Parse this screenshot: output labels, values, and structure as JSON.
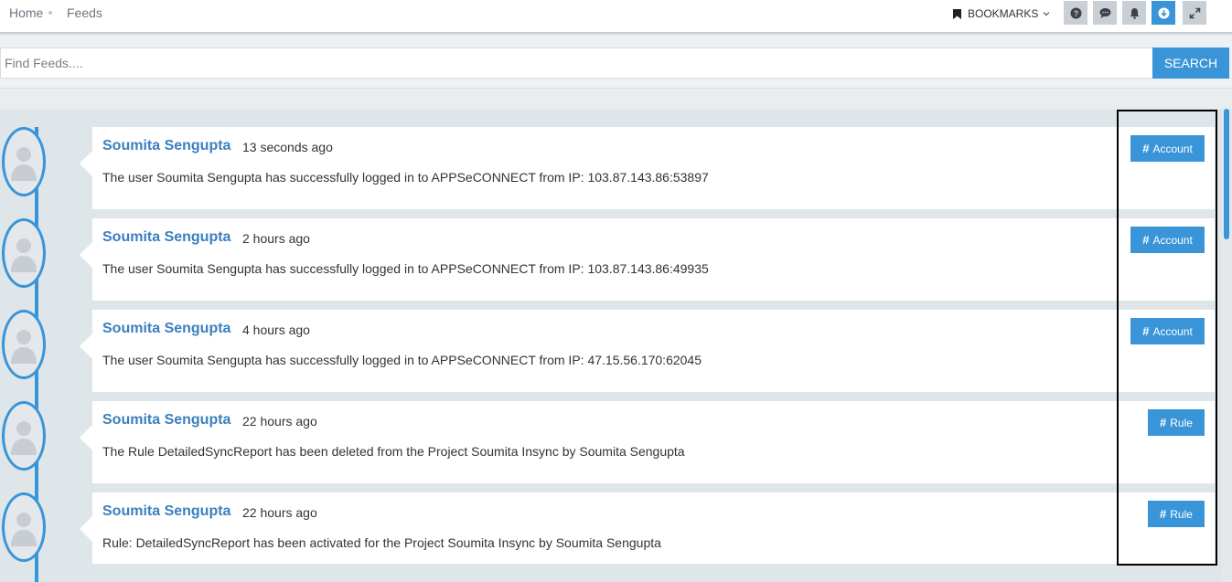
{
  "breadcrumb": {
    "home": "Home",
    "feeds": "Feeds"
  },
  "toolbar": {
    "bookmarks_label": "BOOKMARKS",
    "icons": [
      "help-icon",
      "chat-icon",
      "bell-icon",
      "download-icon",
      "expand-icon"
    ]
  },
  "search": {
    "placeholder": "Find Feeds....",
    "button": "SEARCH"
  },
  "colors": {
    "accent": "#3a95d8",
    "name": "#3b7fbf",
    "timeline_bg": "#dfe6ea"
  },
  "feeds": [
    {
      "name": "Soumita Sengupta",
      "time": "13 seconds ago",
      "message": "The user Soumita Sengupta has successfully logged in to APPSeCONNECT from IP: 103.87.143.86:53897",
      "tag": "Account"
    },
    {
      "name": "Soumita Sengupta",
      "time": "2 hours ago",
      "message": "The user Soumita Sengupta has successfully logged in to APPSeCONNECT from IP: 103.87.143.86:49935",
      "tag": "Account"
    },
    {
      "name": "Soumita Sengupta",
      "time": "4 hours ago",
      "message": "The user Soumita Sengupta has successfully logged in to APPSeCONNECT from IP: 47.15.56.170:62045",
      "tag": "Account"
    },
    {
      "name": "Soumita Sengupta",
      "time": "22 hours ago",
      "message": "The Rule DetailedSyncReport has been deleted from the Project Soumita Insync by Soumita Sengupta",
      "tag": "Rule"
    },
    {
      "name": "Soumita Sengupta",
      "time": "22 hours ago",
      "message": "Rule: DetailedSyncReport has been activated for the Project Soumita Insync by Soumita Sengupta",
      "tag": "Rule"
    }
  ]
}
